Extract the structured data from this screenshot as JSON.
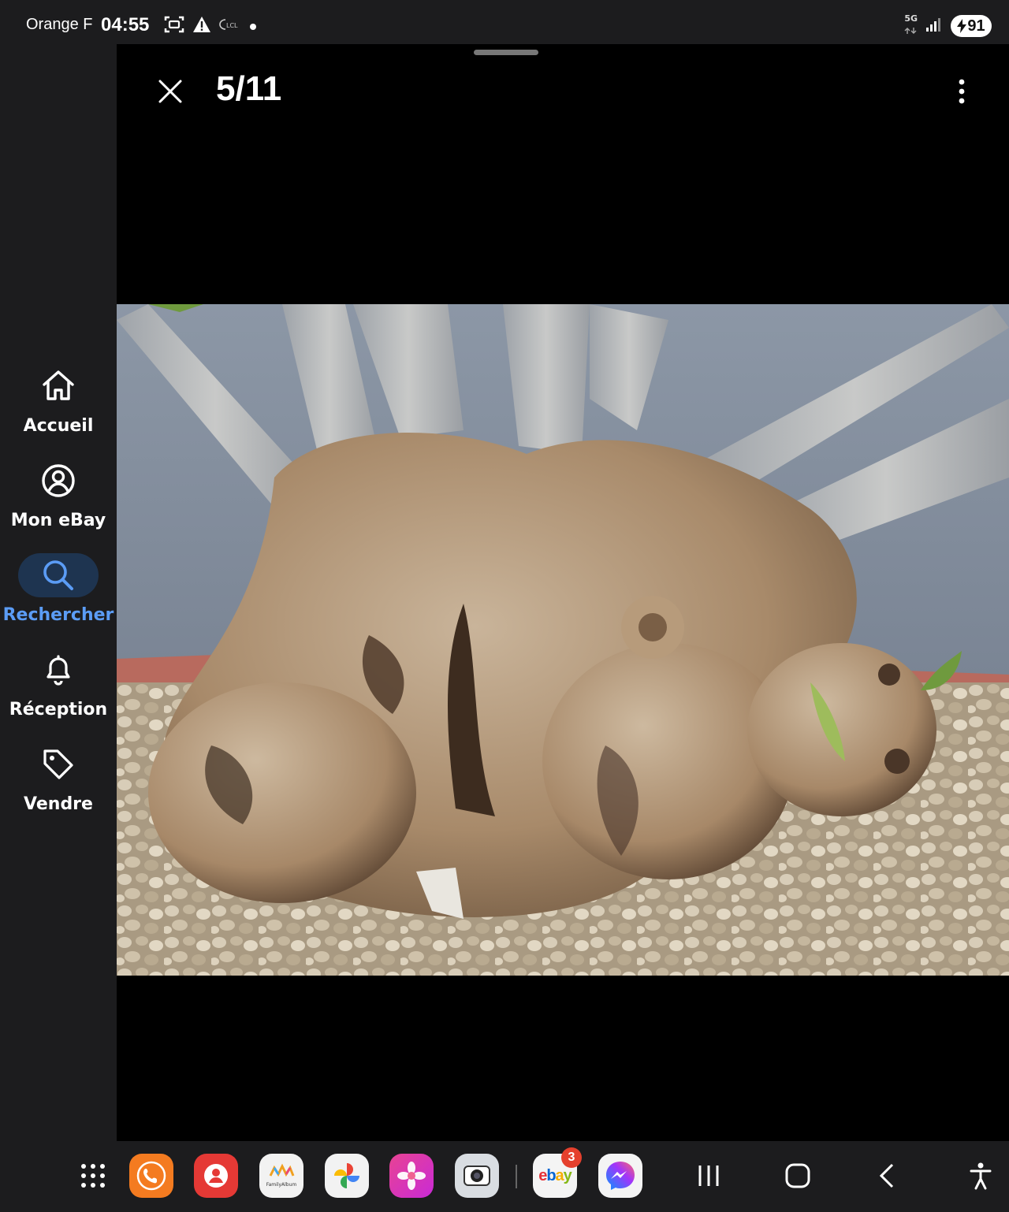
{
  "status_bar": {
    "carrier": "Orange F",
    "time": "04:55",
    "network": "5G",
    "battery": "91",
    "lcl_label": "LCL"
  },
  "nav": {
    "items": [
      {
        "label": "Accueil",
        "icon": "home-icon",
        "active": false
      },
      {
        "label": "Mon eBay",
        "icon": "account-icon",
        "active": false
      },
      {
        "label": "Rechercher",
        "icon": "search-icon",
        "active": true
      },
      {
        "label": "Réception",
        "icon": "bell-icon",
        "active": false
      },
      {
        "label": "Vendre",
        "icon": "tag-icon",
        "active": false
      }
    ],
    "active_color": "#5b9cf5"
  },
  "viewer": {
    "counter": "5/11",
    "photo_subject": "bonsai-caudex-photo"
  },
  "taskbar": {
    "apps": [
      {
        "name": "apps-grid-icon"
      },
      {
        "name": "phone-app-icon"
      },
      {
        "name": "contacts-app-icon"
      },
      {
        "name": "family-album-app-icon",
        "label": "FamilyAlbum"
      },
      {
        "name": "google-photos-app-icon"
      },
      {
        "name": "gallery-app-icon"
      },
      {
        "name": "camera-app-icon"
      },
      {
        "name": "ebay-app-icon",
        "label": "ebay",
        "badge": "3"
      },
      {
        "name": "messenger-app-icon"
      }
    ],
    "nav_buttons": [
      "recents-button",
      "home-button",
      "back-button",
      "accessibility-button"
    ]
  }
}
